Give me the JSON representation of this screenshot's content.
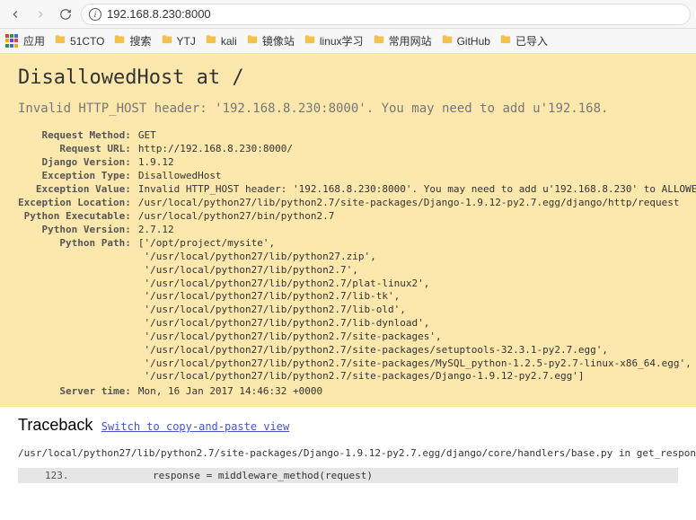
{
  "browser": {
    "url": "192.168.8.230:8000",
    "apps_label": "应用",
    "bookmarks": [
      "51CTO",
      "搜索",
      "YTJ",
      "kali",
      "镜像站",
      "linux学习",
      "常用网站",
      "GitHub",
      "已导入"
    ]
  },
  "django": {
    "heading": "DisallowedHost at /",
    "subtitle": "Invalid HTTP_HOST header: '192.168.8.230:8000'. You may need to add u'192.168.",
    "rows": {
      "request_method": {
        "label": "Request Method:",
        "value": "GET"
      },
      "request_url": {
        "label": "Request URL:",
        "value": "http://192.168.8.230:8000/"
      },
      "django_version": {
        "label": "Django Version:",
        "value": "1.9.12"
      },
      "exception_type": {
        "label": "Exception Type:",
        "value": "DisallowedHost"
      },
      "exception_value": {
        "label": "Exception Value:",
        "value": "Invalid HTTP_HOST header: '192.168.8.230:8000'. You may need to add u'192.168.8.230' to ALLOWED_HO"
      },
      "exception_location": {
        "label": "Exception Location:",
        "value": "/usr/local/python27/lib/python2.7/site-packages/Django-1.9.12-py2.7.egg/django/http/request"
      },
      "python_executable": {
        "label": "Python Executable:",
        "value": "/usr/local/python27/bin/python2.7"
      },
      "python_version": {
        "label": "Python Version:",
        "value": "2.7.12"
      },
      "python_path": {
        "label": "Python Path:",
        "value": "['/opt/project/mysite',\n '/usr/local/python27/lib/python27.zip',\n '/usr/local/python27/lib/python2.7',\n '/usr/local/python27/lib/python2.7/plat-linux2',\n '/usr/local/python27/lib/python2.7/lib-tk',\n '/usr/local/python27/lib/python2.7/lib-old',\n '/usr/local/python27/lib/python2.7/lib-dynload',\n '/usr/local/python27/lib/python2.7/site-packages',\n '/usr/local/python27/lib/python2.7/site-packages/setuptools-32.3.1-py2.7.egg',\n '/usr/local/python27/lib/python2.7/site-packages/MySQL_python-1.2.5-py2.7-linux-x86_64.egg',\n '/usr/local/python27/lib/python2.7/site-packages/Django-1.9.12-py2.7.egg']"
      },
      "server_time": {
        "label": "Server time:",
        "value": "Mon, 16 Jan 2017 14:46:32 +0000"
      }
    }
  },
  "traceback": {
    "heading": "Traceback",
    "switch_label": "Switch to copy-and-paste view",
    "file_line": "/usr/local/python27/lib/python2.7/site-packages/Django-1.9.12-py2.7.egg/django/core/handlers/base.py in get_response",
    "lineno": "123.",
    "code": "response = middleware_method(request)"
  },
  "colors": {
    "apps_grid": [
      "#d9453c",
      "#3a8e3a",
      "#3a6fd9",
      "#e0b020",
      "#7a3ad9",
      "#d9453c",
      "#3a8e3a",
      "#3a6fd9",
      "#e0b020"
    ]
  }
}
